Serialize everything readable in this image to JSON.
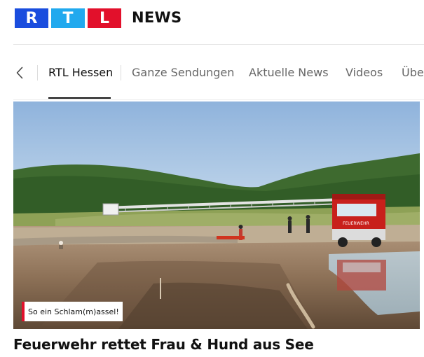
{
  "header": {
    "logo_letters": [
      "R",
      "T",
      "L"
    ],
    "logo_colors": [
      "#1a4dde",
      "#21a9ee",
      "#e2102b"
    ],
    "brand_suffix": "NEWS"
  },
  "nav": {
    "back_icon": "chevron-left-icon",
    "items": [
      {
        "label": "RTL Hessen",
        "active": true
      },
      {
        "label": "Ganze Sendungen",
        "active": false
      },
      {
        "label": "Aktuelle News",
        "active": false
      },
      {
        "label": "Videos",
        "active": false
      },
      {
        "label": "Übe",
        "active": false
      }
    ]
  },
  "article": {
    "image_caption": "So ein Schlam(m)assel!",
    "headline": "Feuerwehr rettet Frau & Hund aus See",
    "truck_label": "FEUERWEHR",
    "accent_color": "#e2102b"
  }
}
